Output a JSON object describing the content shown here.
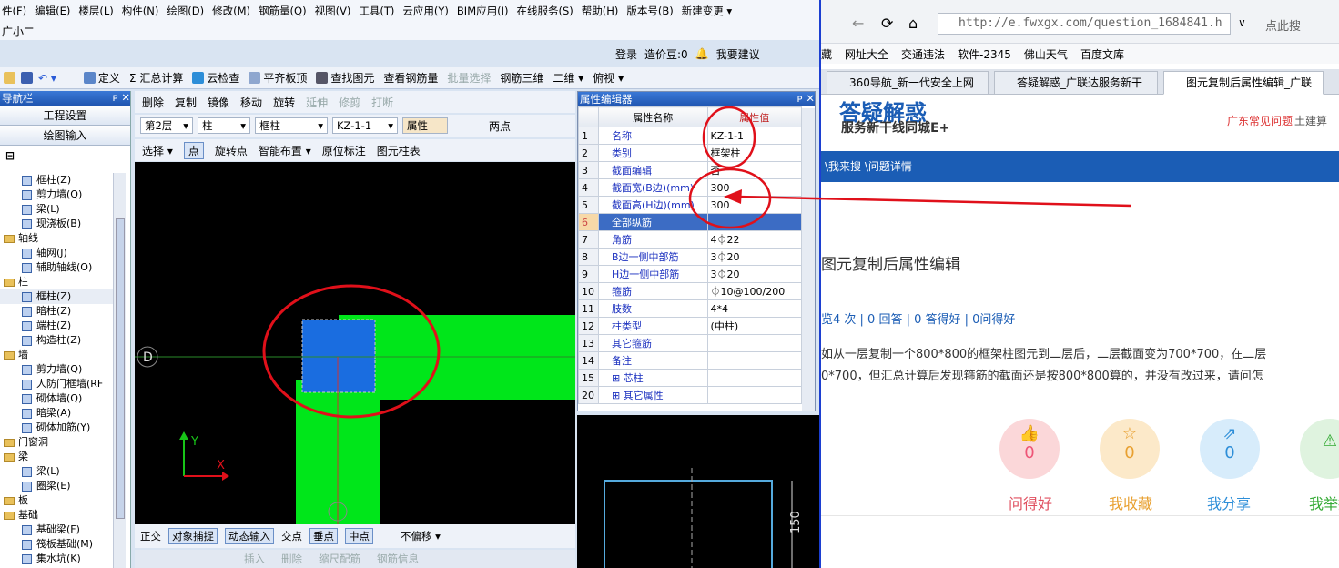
{
  "menu": [
    "件(F)",
    "编辑(E)",
    "楼层(L)",
    "构件(N)",
    "绘图(D)",
    "修改(M)",
    "钢筋量(Q)",
    "视图(V)",
    "工具(T)",
    "云应用(Y)",
    "BIM应用(I)",
    "在线服务(S)",
    "帮助(H)",
    "版本号(B)",
    "新建变更 ▾"
  ],
  "subtitle": "广小二",
  "login": {
    "login": "登录",
    "cost": "造价豆:0",
    "suggest": "我要建议"
  },
  "toolbar1": [
    "定义",
    "Σ 汇总计算",
    "云检查",
    "平齐板顶",
    "查找图元",
    "查看钢筋量",
    "批量选择",
    "钢筋三维",
    "二维 ▾",
    "俯视 ▾"
  ],
  "nav": {
    "title": "导航栏",
    "btn1": "工程设置",
    "btn2": "绘图输入",
    "items": [
      {
        "t": "框柱(Z)",
        "k": "leaf"
      },
      {
        "t": "剪力墙(Q)",
        "k": "leaf"
      },
      {
        "t": "梁(L)",
        "k": "leaf"
      },
      {
        "t": "现浇板(B)",
        "k": "leaf"
      },
      {
        "t": "轴线",
        "k": "fold"
      },
      {
        "t": "轴网(J)",
        "k": "leaf"
      },
      {
        "t": "辅助轴线(O)",
        "k": "leaf"
      },
      {
        "t": "柱",
        "k": "fold"
      },
      {
        "t": "框柱(Z)",
        "k": "leaf"
      },
      {
        "t": "暗柱(Z)",
        "k": "leaf"
      },
      {
        "t": "端柱(Z)",
        "k": "leaf"
      },
      {
        "t": "构造柱(Z)",
        "k": "leaf"
      },
      {
        "t": "墙",
        "k": "fold"
      },
      {
        "t": "剪力墙(Q)",
        "k": "leaf"
      },
      {
        "t": "人防门框墙(RF",
        "k": "leaf"
      },
      {
        "t": "砌体墙(Q)",
        "k": "leaf"
      },
      {
        "t": "暗梁(A)",
        "k": "leaf"
      },
      {
        "t": "砌体加筋(Y)",
        "k": "leaf"
      },
      {
        "t": "门窗洞",
        "k": "fold"
      },
      {
        "t": "梁",
        "k": "fold"
      },
      {
        "t": "梁(L)",
        "k": "leaf"
      },
      {
        "t": "圈梁(E)",
        "k": "leaf"
      },
      {
        "t": "板",
        "k": "fold"
      },
      {
        "t": "基础",
        "k": "fold"
      },
      {
        "t": "基础梁(F)",
        "k": "leaf"
      },
      {
        "t": "筏板基础(M)",
        "k": "leaf"
      },
      {
        "t": "集水坑(K)",
        "k": "leaf"
      }
    ]
  },
  "toolbar2": [
    "删除",
    "复制",
    "镜像",
    "移动",
    "旋转",
    "延伸",
    "修剪",
    "打断"
  ],
  "toolbar3": {
    "floor": "第2层",
    "type": "柱",
    "sub": "框柱",
    "name": "KZ-1-1",
    "prop": "属性",
    "twopt": "两点"
  },
  "toolbar4": [
    "选择 ▾",
    "点",
    "旋转点",
    "智能布置 ▾",
    "原位标注",
    "图元柱表"
  ],
  "canvas": {
    "axis_d": "D",
    "y": "Y",
    "x": "X"
  },
  "bottombar": [
    "正交",
    "对象捕捉",
    "动态输入",
    "交点",
    "垂点",
    "中点",
    "不偏移 ▾"
  ],
  "bottombar2": [
    "插入",
    "删除",
    "缩尺配筋",
    "钢筋信息"
  ],
  "prop": {
    "title": "属性编辑器",
    "col_name": "属性名称",
    "col_val": "属性值",
    "rows": [
      {
        "no": "1",
        "n": "名称",
        "v": "KZ-1-1"
      },
      {
        "no": "2",
        "n": "类别",
        "v": "框架柱"
      },
      {
        "no": "3",
        "n": "截面编辑",
        "v": "否"
      },
      {
        "no": "4",
        "n": "截面宽(B边)(mm)",
        "v": "300"
      },
      {
        "no": "5",
        "n": "截面高(H边)(mm)",
        "v": "300"
      },
      {
        "no": "6",
        "n": "全部纵筋",
        "v": ""
      },
      {
        "no": "7",
        "n": "角筋",
        "v": "4⏀22"
      },
      {
        "no": "8",
        "n": "B边一侧中部筋",
        "v": "3⏀20"
      },
      {
        "no": "9",
        "n": "H边一侧中部筋",
        "v": "3⏀20"
      },
      {
        "no": "10",
        "n": "箍筋",
        "v": "⏀10@100/200"
      },
      {
        "no": "11",
        "n": "肢数",
        "v": "4*4"
      },
      {
        "no": "12",
        "n": "柱类型",
        "v": "(中柱)"
      },
      {
        "no": "13",
        "n": "其它箍筋",
        "v": ""
      },
      {
        "no": "14",
        "n": "备注",
        "v": ""
      },
      {
        "no": "15",
        "n": "⊞ 芯柱",
        "v": ""
      },
      {
        "no": "20",
        "n": "⊞ 其它属性",
        "v": ""
      }
    ]
  },
  "section": {
    "dim": "150"
  },
  "browser": {
    "url": "http://e.fwxgx.com/question_1684841.h",
    "search": "点此搜",
    "fav": [
      "藏",
      "网址大全",
      "交通违法",
      "软件-2345",
      "佛山天气",
      "百度文库"
    ],
    "tabs": [
      "360导航_新一代安全上网",
      "答疑解惑_广联达服务新干",
      "图元复制后属性编辑_广联"
    ],
    "logo": "答疑解惑",
    "slogan": "服务新干线同城E+",
    "link1": "广东常见问题",
    "link2": "土建算",
    "crumb": "\\我来搜 \\问题详情",
    "qtitle": "图元复制后属性编辑",
    "stats": "览4 次 | 0 回答 | 0 答得好 | 0问得好",
    "q1": "如从一层复制一个800*800的框架柱图元到二层后，二层截面变为700*700，在二层",
    "q2": "0*700，但汇总计算后发现箍筋的截面还是按800*800算的，并没有改过来，请问怎",
    "actions": [
      {
        "label": "问得好",
        "n": "0"
      },
      {
        "label": "我收藏",
        "n": "0"
      },
      {
        "label": "我分享",
        "n": "0"
      },
      {
        "label": "我举报",
        "n": ""
      }
    ]
  },
  "colors": {
    "accent": "#1b5db5",
    "annotation": "#e0101a",
    "green": "#00e61a"
  }
}
